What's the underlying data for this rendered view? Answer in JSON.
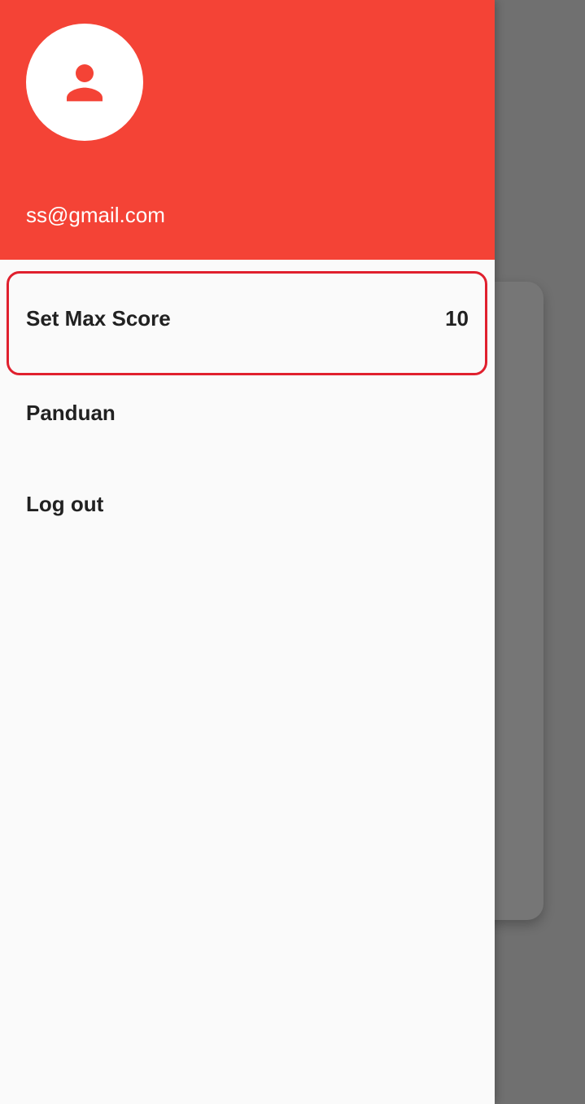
{
  "drawer": {
    "header": {
      "email": "ss@gmail.com",
      "avatar_icon": "person-icon",
      "background_color": "#f44336"
    },
    "items": [
      {
        "label": "Set Max Score",
        "value": "10"
      },
      {
        "label": "Panduan"
      },
      {
        "label": "Log out"
      }
    ]
  }
}
